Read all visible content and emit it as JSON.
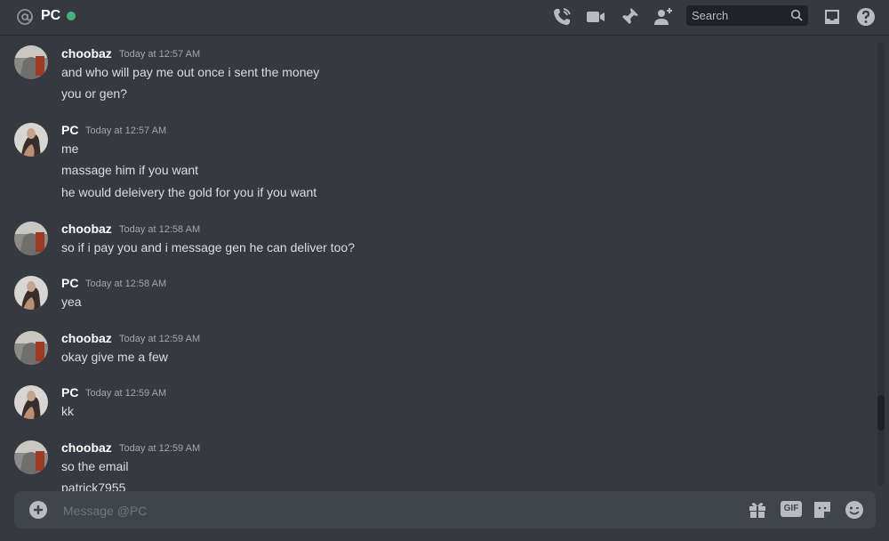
{
  "header": {
    "channel_name": "PC",
    "status_color": "#43b581",
    "icons": [
      "at-icon",
      "call-icon",
      "video-icon",
      "pin-icon",
      "add-user-icon",
      "inbox-icon",
      "help-icon"
    ],
    "search_placeholder": "Search"
  },
  "messages": [
    {
      "author": "choobaz",
      "timestamp": "Today at 12:57 AM",
      "avatar": "choobaz-avatar",
      "lines": [
        "and who will pay me out once i sent the money",
        "you or gen?"
      ]
    },
    {
      "author": "PC",
      "timestamp": "Today at 12:57 AM",
      "avatar": "pc-avatar",
      "lines": [
        "me",
        "massage him if you want",
        "he would deleivery the gold for you if you want"
      ]
    },
    {
      "author": "choobaz",
      "timestamp": "Today at 12:58 AM",
      "avatar": "choobaz-avatar",
      "lines": [
        "so if i pay you and i message gen he can deliver too?"
      ]
    },
    {
      "author": "PC",
      "timestamp": "Today at 12:58 AM",
      "avatar": "pc-avatar",
      "lines": [
        "yea"
      ]
    },
    {
      "author": "choobaz",
      "timestamp": "Today at 12:59 AM",
      "avatar": "choobaz-avatar",
      "lines": [
        "okay give me a few"
      ]
    },
    {
      "author": "PC",
      "timestamp": "Today at 12:59 AM",
      "avatar": "pc-avatar",
      "lines": [
        "kk"
      ]
    },
    {
      "author": "choobaz",
      "timestamp": "Today at 12:59 AM",
      "avatar": "choobaz-avatar",
      "lines": [
        "so the email",
        "patrick7955"
      ]
    }
  ],
  "composer": {
    "placeholder": "Message @PC",
    "gif_label": "GIF",
    "icons": [
      "add-icon",
      "gift-icon",
      "gif-icon",
      "sticker-icon",
      "emoji-icon"
    ]
  }
}
